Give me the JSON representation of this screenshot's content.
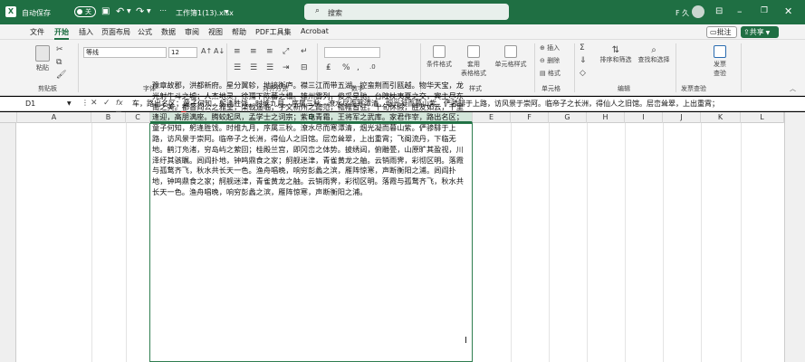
{
  "window": {
    "autosave_label": "自动保存",
    "autosave_state": "关",
    "file_name": "工作簿1(13).xlsx",
    "user": "F 久"
  },
  "search": {
    "placeholder": "搜索"
  },
  "menu": [
    "文件",
    "开始",
    "插入",
    "页面布局",
    "公式",
    "数据",
    "审阅",
    "视图",
    "帮助",
    "PDF工具集",
    "Acrobat"
  ],
  "menu_active": "开始",
  "menu_right": {
    "comment": "批注",
    "share": "共享"
  },
  "ribbon": {
    "clipboard": {
      "paste": "粘贴",
      "group": "剪贴板"
    },
    "font": {
      "name": "等线",
      "size": "12",
      "group": "字体",
      "bold": "B",
      "italic": "I",
      "underline": "U",
      "font_color": "A"
    },
    "alignment": {
      "group": "对齐方式"
    },
    "number": {
      "group": "数字",
      "format": "%"
    },
    "styles": {
      "conditional": "条件格式",
      "table": "套用\n表格格式",
      "cell": "单元格样式",
      "group": "样式"
    },
    "cells": {
      "insert": "插入",
      "delete": "删除",
      "format": "格式",
      "group": "单元格"
    },
    "editing": {
      "sort": "排序和筛选",
      "find": "查找和选择",
      "group": "编辑"
    },
    "invoice": {
      "label": "发票\n查验",
      "group": "发票查验"
    }
  },
  "formula_bar": {
    "name_box": "D1",
    "fx": "fx",
    "content": "车，路出名区；童子何知，躬逢胜饯。时维九月，序属三秋。潦水尽而寒潭清，烟光凝而暮山紫。俨骖騑于上路，访风景于崇阿。临帝子之长洲，得仙人之旧馆。层峦耸翠，上出重霄；"
  },
  "columns": [
    "A",
    "B",
    "C",
    "D",
    "E",
    "F",
    "G",
    "H",
    "I",
    "J",
    "K",
    "L"
  ],
  "cell_text": "豫章故郡，洪都新府。星分翼轸，地接衡庐。襟三江而带五湖，控蛮荆而引瓯越。物华天宝，龙光射牛斗之墟；人杰地灵，徐孺下陈蕃之榻。雄州雾列，俊采星驰。台隍枕夷夏之交，宾主尽东南之美。都督阎公之雅望，棨戟遥临；宇文新州之懿范，襜帷暂驻。十旬休假，胜友如云，千里逢迎，高朋满座。腾蛟起凤，孟学士之词宗；紫电青霜，王将军之武库。家君作宰，路出名区；童子何知，躬逢胜饯。时维九月，序属三秋。潦水尽而寒潭清，烟光凝而暮山紫。俨骖騑于上路，访风景于崇阿。临帝子之长洲，得仙人之旧馆。层峦耸翠，上出重霄；飞阁流丹，下临无地。鹤汀凫渚，穷岛屿之萦回；桂殿兰宫，即冈峦之体势。披绣闼，俯雕甍，山原旷其盈视，川泽纡其骇瞩。闾阎扑地，钟鸣鼎食之家；舸舰迷津，青雀黄龙之舳。云销雨霁，彩彻区明。落霞与孤鹜齐飞，秋水共长天一色。渔舟唱晚，响穷彭蠡之滨，雁阵惊寒，声断衡阳之浦。闾阎扑地，钟鸣鼎食之家；舸舰迷津，青雀黄龙之舳。云销雨霁，彩彻区明。落霞与孤鹜齐飞，秋水共长天一色。渔舟唱晚，响穷彭蠡之滨，雁阵惊寒，声断衡阳之浦。",
  "colors": {
    "brand": "#1f6f43",
    "ribbon": "#f3f3f3",
    "selection": "#2e7d4f"
  }
}
